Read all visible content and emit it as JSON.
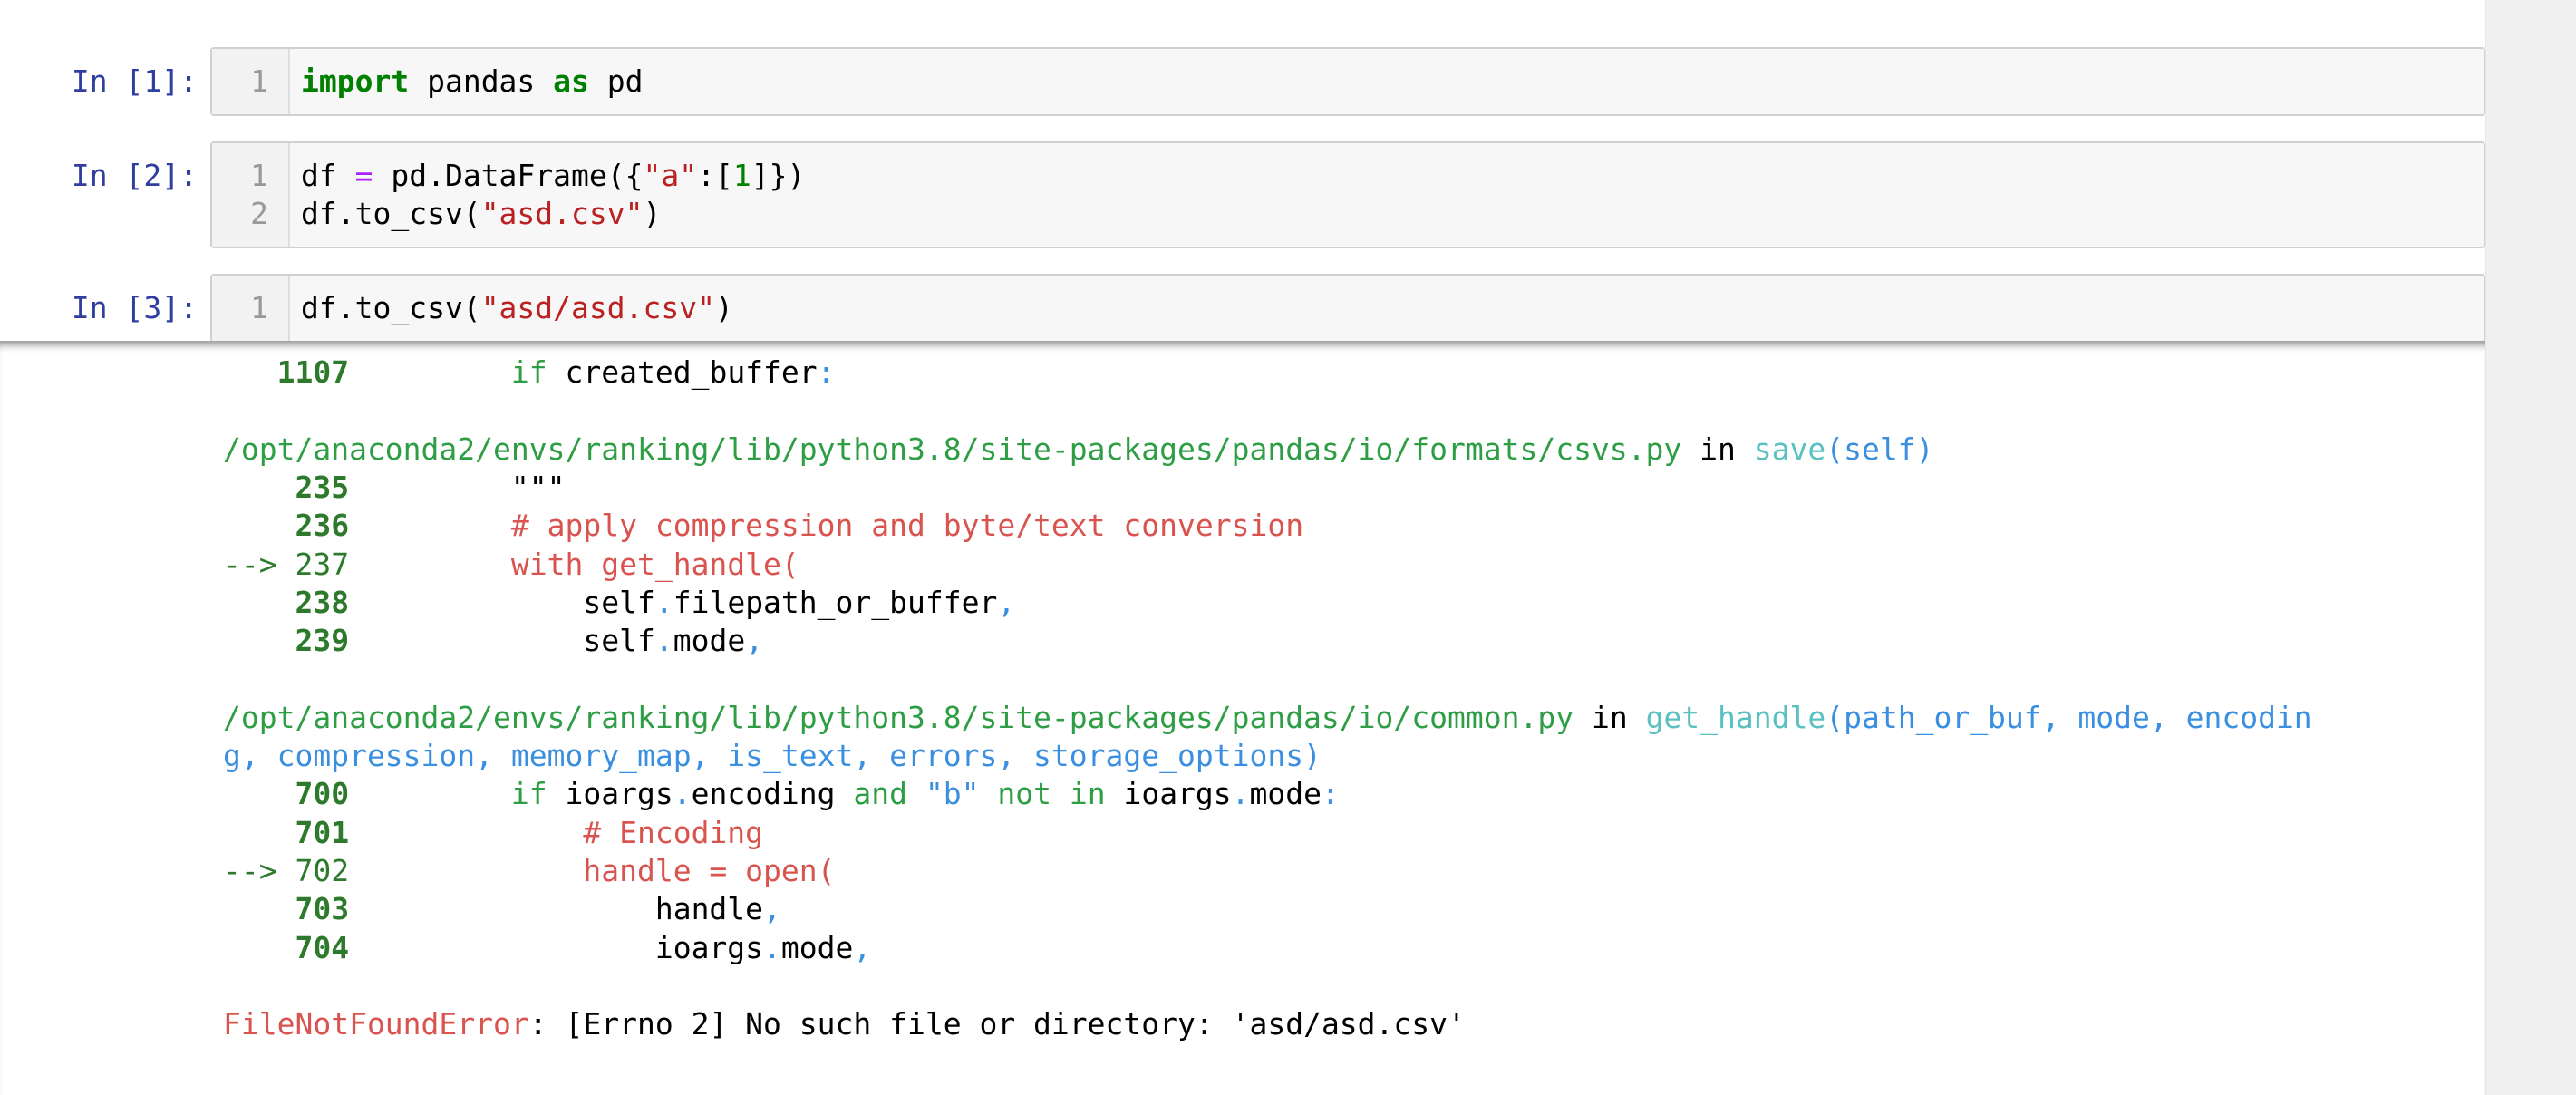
{
  "cells": [
    {
      "prompt": "In [1]:",
      "lines": [
        {
          "num": "1",
          "tokens": [
            {
              "t": "import",
              "c": "kw"
            },
            {
              "t": " pandas ",
              "c": ""
            },
            {
              "t": "as",
              "c": "kw"
            },
            {
              "t": " pd",
              "c": ""
            }
          ]
        }
      ]
    },
    {
      "prompt": "In [2]:",
      "lines": [
        {
          "num": "1",
          "tokens": [
            {
              "t": "df ",
              "c": ""
            },
            {
              "t": "=",
              "c": "op"
            },
            {
              "t": " pd.DataFrame({",
              "c": ""
            },
            {
              "t": "\"a\"",
              "c": "str"
            },
            {
              "t": ":[",
              "c": ""
            },
            {
              "t": "1",
              "c": "num"
            },
            {
              "t": "]})",
              "c": ""
            }
          ]
        },
        {
          "num": "2",
          "tokens": [
            {
              "t": "df.to_csv(",
              "c": ""
            },
            {
              "t": "\"asd.csv\"",
              "c": "str"
            },
            {
              "t": ")",
              "c": ""
            }
          ]
        }
      ]
    },
    {
      "prompt": "In [3]:",
      "lines": [
        {
          "num": "1",
          "tokens": [
            {
              "t": "df.to_csv(",
              "c": ""
            },
            {
              "t": "\"asd/asd.csv\"",
              "c": "str"
            },
            {
              "t": ")",
              "c": ""
            }
          ]
        }
      ]
    }
  ],
  "traceback": {
    "lines": [
      {
        "tokens": [
          {
            "t": "   1107",
            "c": "tb-num"
          },
          {
            "t": "         ",
            "c": ""
          },
          {
            "t": "if",
            "c": "tb-green"
          },
          {
            "t": " created_buffer",
            "c": "tb-black"
          },
          {
            "t": ":",
            "c": "tb-blue"
          }
        ]
      },
      {
        "tokens": []
      },
      {
        "tokens": [
          {
            "t": "/opt/anaconda2/envs/ranking/lib/python3.8/site-packages/pandas/io/formats/csvs.py",
            "c": "tb-path"
          },
          {
            "t": " in ",
            "c": "tb-black"
          },
          {
            "t": "save",
            "c": "tb-cyan"
          },
          {
            "t": "(self)",
            "c": "tb-blue"
          }
        ]
      },
      {
        "tokens": [
          {
            "t": "    235",
            "c": "tb-num"
          },
          {
            "t": "         \"\"\"",
            "c": "tb-black"
          }
        ]
      },
      {
        "tokens": [
          {
            "t": "    236",
            "c": "tb-num"
          },
          {
            "t": "         # apply compression and byte/text conversion",
            "c": "tb-red"
          }
        ]
      },
      {
        "tokens": [
          {
            "t": "--> 237",
            "c": "tb-arrow"
          },
          {
            "t": "         with get_handle(",
            "c": "tb-red"
          }
        ]
      },
      {
        "tokens": [
          {
            "t": "    238",
            "c": "tb-num"
          },
          {
            "t": "             self",
            "c": "tb-black"
          },
          {
            "t": ".",
            "c": "tb-blue"
          },
          {
            "t": "filepath_or_buffer",
            "c": "tb-black"
          },
          {
            "t": ",",
            "c": "tb-blue"
          }
        ]
      },
      {
        "tokens": [
          {
            "t": "    239",
            "c": "tb-num"
          },
          {
            "t": "             self",
            "c": "tb-black"
          },
          {
            "t": ".",
            "c": "tb-blue"
          },
          {
            "t": "mode",
            "c": "tb-black"
          },
          {
            "t": ",",
            "c": "tb-blue"
          }
        ]
      },
      {
        "tokens": []
      },
      {
        "tokens": [
          {
            "t": "/opt/anaconda2/envs/ranking/lib/python3.8/site-packages/pandas/io/common.py",
            "c": "tb-path"
          },
          {
            "t": " in ",
            "c": "tb-black"
          },
          {
            "t": "get_handle",
            "c": "tb-cyan"
          },
          {
            "t": "(path_or_buf, mode, encodin",
            "c": "tb-blue"
          }
        ]
      },
      {
        "tokens": [
          {
            "t": "g, compression, memory_map, is_text, errors, storage_options)",
            "c": "tb-blue"
          }
        ]
      },
      {
        "tokens": [
          {
            "t": "    700",
            "c": "tb-num"
          },
          {
            "t": "         ",
            "c": ""
          },
          {
            "t": "if",
            "c": "tb-green"
          },
          {
            "t": " ioargs",
            "c": "tb-black"
          },
          {
            "t": ".",
            "c": "tb-blue"
          },
          {
            "t": "encoding ",
            "c": "tb-black"
          },
          {
            "t": "and",
            "c": "tb-green"
          },
          {
            "t": " \"b\" ",
            "c": "tb-blue"
          },
          {
            "t": "not",
            "c": "tb-green"
          },
          {
            "t": " ",
            "c": ""
          },
          {
            "t": "in",
            "c": "tb-green"
          },
          {
            "t": " ioargs",
            "c": "tb-black"
          },
          {
            "t": ".",
            "c": "tb-blue"
          },
          {
            "t": "mode",
            "c": "tb-black"
          },
          {
            "t": ":",
            "c": "tb-blue"
          }
        ]
      },
      {
        "tokens": [
          {
            "t": "    701",
            "c": "tb-num"
          },
          {
            "t": "             # Encoding",
            "c": "tb-red"
          }
        ]
      },
      {
        "tokens": [
          {
            "t": "--> 702",
            "c": "tb-arrow"
          },
          {
            "t": "             handle = open(",
            "c": "tb-red"
          }
        ]
      },
      {
        "tokens": [
          {
            "t": "    703",
            "c": "tb-num"
          },
          {
            "t": "                 handle",
            "c": "tb-black"
          },
          {
            "t": ",",
            "c": "tb-blue"
          }
        ]
      },
      {
        "tokens": [
          {
            "t": "    704",
            "c": "tb-num"
          },
          {
            "t": "                 ioargs",
            "c": "tb-black"
          },
          {
            "t": ".",
            "c": "tb-blue"
          },
          {
            "t": "mode",
            "c": "tb-black"
          },
          {
            "t": ",",
            "c": "tb-blue"
          }
        ]
      },
      {
        "tokens": []
      },
      {
        "tokens": [
          {
            "t": "FileNotFoundError",
            "c": "tb-err"
          },
          {
            "t": ": [Errno 2] No such file or directory: 'asd/asd.csv'",
            "c": "tb-black"
          }
        ]
      }
    ]
  },
  "colors": {
    "prompt": "#303f9f",
    "keyword": "#008000",
    "string": "#ba2121",
    "operator": "#aa22ff",
    "traceback_red": "#d9534f",
    "traceback_green": "#2e9e45",
    "traceback_blue": "#3a8fe0"
  }
}
